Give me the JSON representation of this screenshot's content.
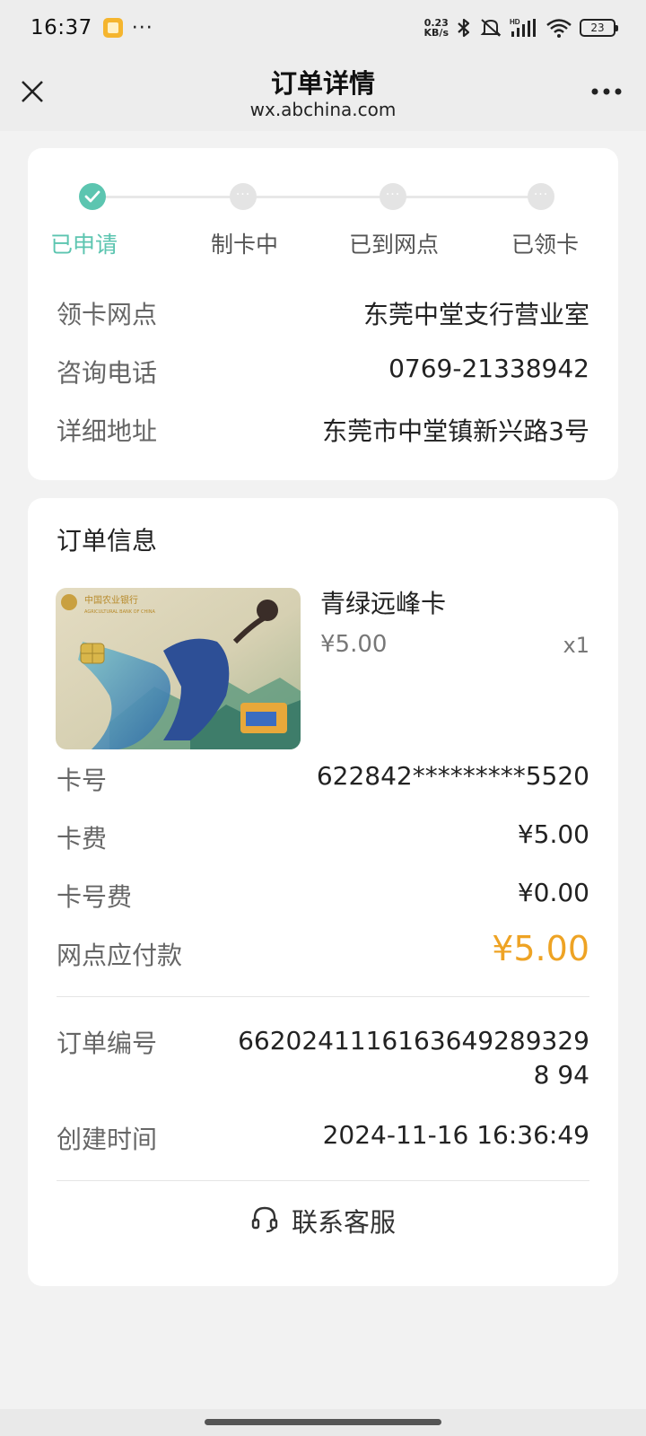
{
  "status_bar": {
    "time": "16:37",
    "dots": "···",
    "net_speed_value": "0.23",
    "net_speed_unit": "KB/s",
    "battery": "23"
  },
  "nav": {
    "title": "订单详情",
    "subtitle": "wx.abchina.com"
  },
  "progress": {
    "steps": [
      {
        "label": "已申请",
        "state": "done"
      },
      {
        "label": "制卡中",
        "state": "pending"
      },
      {
        "label": "已到网点",
        "state": "pending"
      },
      {
        "label": "已领卡",
        "state": "pending"
      }
    ],
    "accent_color": "#5cc5b0"
  },
  "branch": {
    "rows": [
      {
        "key": "领卡网点",
        "value": "东莞中堂支行营业室"
      },
      {
        "key": "咨询电话",
        "value": "0769-21338942"
      },
      {
        "key": "详细地址",
        "value": "东莞市中堂镇新兴路3号"
      }
    ]
  },
  "order": {
    "section_title": "订单信息",
    "bank_name_cn": "中国农业银行",
    "bank_name_en": "AGRICULTURAL BANK OF CHINA",
    "product_name": "青绿远峰卡",
    "product_price": "¥5.00",
    "product_qty": "x1",
    "card_number_label": "卡号",
    "card_number": "622842*********5520",
    "card_fee_label": "卡费",
    "card_fee": "¥5.00",
    "number_fee_label": "卡号费",
    "number_fee": "¥0.00",
    "payable_label": "网点应付款",
    "payable": "¥5.00",
    "payable_color": "#eea324",
    "order_no_label": "订单编号",
    "order_no": "66202411161636492893298 94",
    "created_label": "创建时间",
    "created": "2024-11-16 16:36:49",
    "contact_label": "联系客服",
    "contact_icon": "headset-icon"
  }
}
